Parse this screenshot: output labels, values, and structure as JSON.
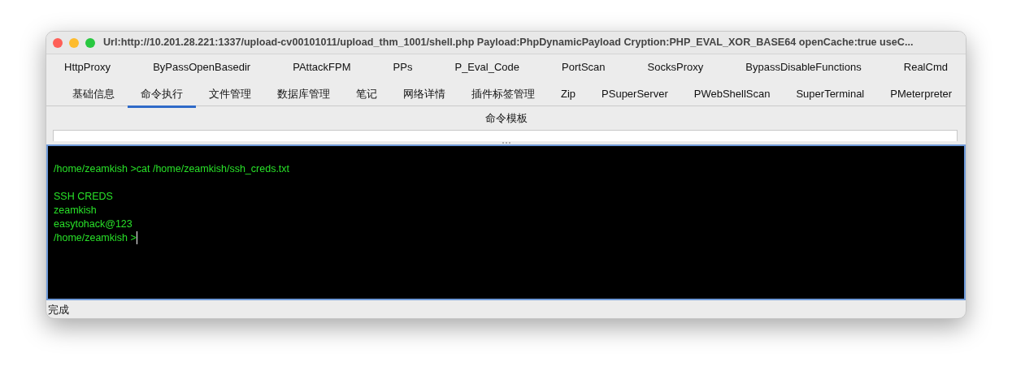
{
  "window": {
    "title": "Url:http://10.201.28.221:1337/upload-cv00101011/upload_thm_1001/shell.php Payload:PhpDynamicPayload Cryption:PHP_EVAL_XOR_BASE64 openCache:true useC..."
  },
  "tab_rows": [
    {
      "tabs": [
        {
          "label": "HttpProxy",
          "selected": false
        },
        {
          "label": "ByPassOpenBasedir",
          "selected": false
        },
        {
          "label": "PAttackFPM",
          "selected": false
        },
        {
          "label": "PPs",
          "selected": false
        },
        {
          "label": "P_Eval_Code",
          "selected": false
        },
        {
          "label": "PortScan",
          "selected": false
        },
        {
          "label": "SocksProxy",
          "selected": false
        },
        {
          "label": "BypassDisableFunctions",
          "selected": false
        },
        {
          "label": "RealCmd",
          "selected": false
        }
      ]
    },
    {
      "tabs": [
        {
          "label": "基础信息",
          "selected": false
        },
        {
          "label": "命令执行",
          "selected": true
        },
        {
          "label": "文件管理",
          "selected": false
        },
        {
          "label": "数据库管理",
          "selected": false
        },
        {
          "label": "笔记",
          "selected": false
        },
        {
          "label": "网络详情",
          "selected": false
        },
        {
          "label": "插件标签管理",
          "selected": false
        },
        {
          "label": "Zip",
          "selected": false
        },
        {
          "label": "PSuperServer",
          "selected": false
        },
        {
          "label": "PWebShellScan",
          "selected": false
        },
        {
          "label": "SuperTerminal",
          "selected": false
        },
        {
          "label": "PMeterpreter",
          "selected": false
        }
      ]
    }
  ],
  "command_template": {
    "label": "命令模板"
  },
  "terminal": {
    "lines": [
      {
        "kind": "command",
        "text": "/home/zeamkish >cat /home/zeamkish/ssh_creds.txt"
      },
      {
        "kind": "output",
        "text": "SSH CREDS"
      },
      {
        "kind": "output",
        "text": "zeamkish"
      },
      {
        "kind": "output",
        "text": "easytohack@123"
      },
      {
        "kind": "prompt",
        "text": "/home/zeamkish >"
      }
    ]
  },
  "status_bar": {
    "text": "完成"
  }
}
